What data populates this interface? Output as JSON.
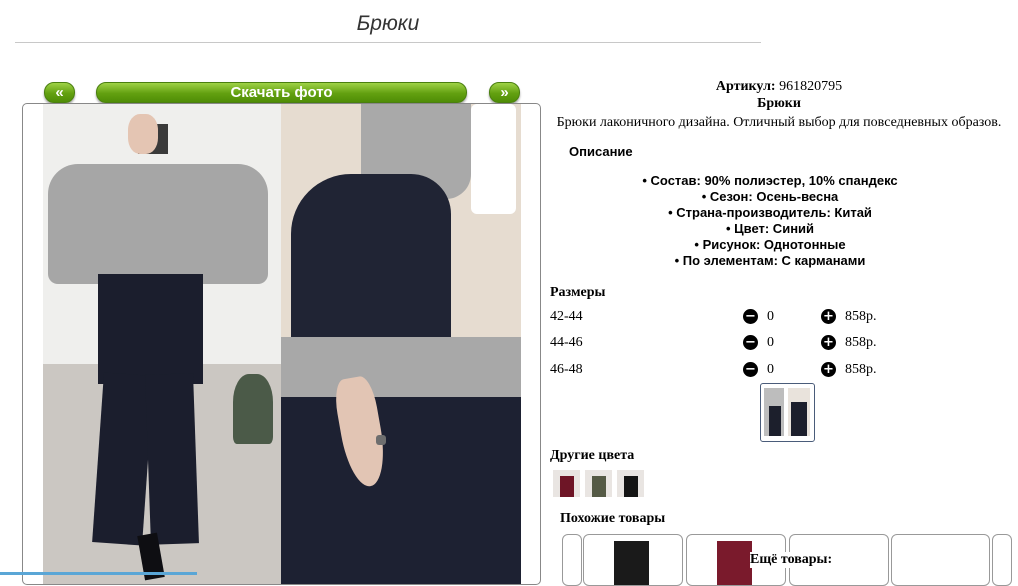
{
  "page": {
    "title": "Брюки"
  },
  "gallery": {
    "prev_label": "«",
    "download_label": "Скачать фото",
    "next_label": "»"
  },
  "product": {
    "article_label": "Артикул:",
    "article_value": "961820795",
    "name": "Брюки",
    "description": "Брюки лаконичного дизайна. Отличный выбор для повседневных образов.",
    "description_heading": "Описание",
    "properties": [
      "Состав: 90% полиэстер, 10% спандекс",
      "Сезон: Осень-весна",
      "Страна-производитель: Китай",
      "Цвет: Синий",
      "Рисунок: Однотонные",
      "По элементам: С карманами"
    ]
  },
  "sizes": {
    "heading": "Размеры",
    "rows": [
      {
        "size": "42-44",
        "qty": "0",
        "price": "858р."
      },
      {
        "size": "44-46",
        "qty": "0",
        "price": "858р."
      },
      {
        "size": "46-48",
        "qty": "0",
        "price": "858р."
      }
    ]
  },
  "other_colors": {
    "heading": "Другие цвета"
  },
  "similar": {
    "heading": "Похожие товары"
  },
  "more": {
    "heading": "Ещё товары:"
  },
  "colors": {
    "accent_green": "#62a010",
    "sweater": "#a9a9a9",
    "pants": "#1a1d2c",
    "floor": "#c9c5c0",
    "wall": "#ecebe9"
  },
  "icons": {
    "minus": "minus-circle-icon",
    "plus": "plus-circle-icon"
  }
}
